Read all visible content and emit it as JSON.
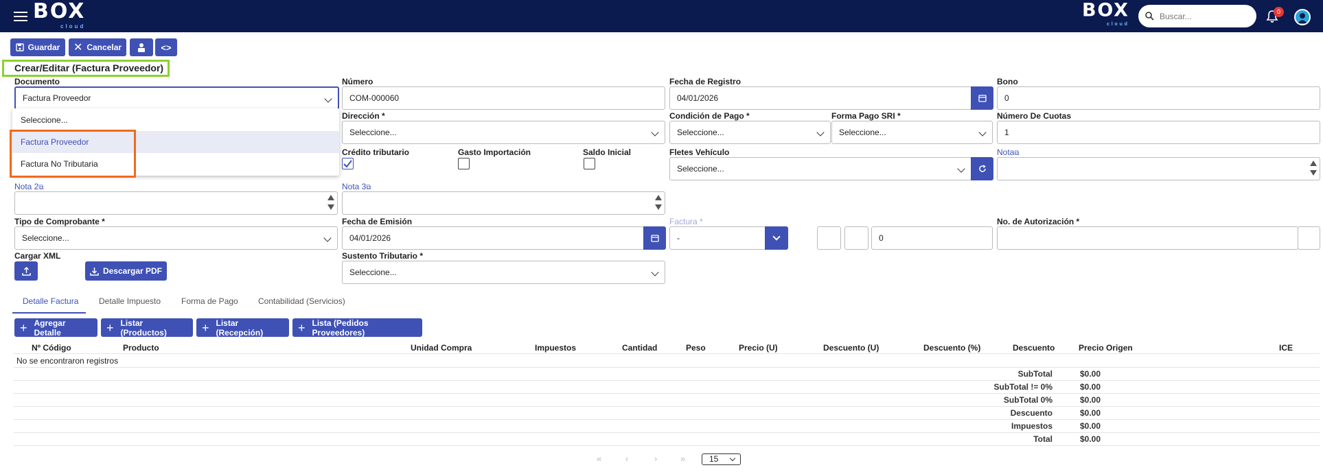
{
  "header": {
    "logo_text": "BOX",
    "logo_sub": "cloud",
    "search_placeholder": "Buscar...",
    "notification_count": "0"
  },
  "toolbar": {
    "save_label": "Guardar",
    "cancel_label": "Cancelar"
  },
  "page_title": "Crear/Editar (Factura Proveedor)",
  "form": {
    "documento": {
      "label": "Documento",
      "value": "Factura Proveedor"
    },
    "documento_options": [
      "Seleccione...",
      "Factura Proveedor",
      "Factura No Tributaria"
    ],
    "numero": {
      "label": "Número",
      "value": "COM-000060"
    },
    "fecha_registro": {
      "label": "Fecha de Registro",
      "value": "04/01/2026"
    },
    "bono": {
      "label": "Bono",
      "value": "0"
    },
    "direccion": {
      "label": "Dirección *",
      "value": "Seleccione..."
    },
    "condicion_pago": {
      "label": "Condición de Pago *",
      "value": "Seleccione..."
    },
    "forma_pago_sri": {
      "label": "Forma Pago SRI *",
      "value": "Seleccione..."
    },
    "numero_cuotas": {
      "label": "Número De Cuotas",
      "value": "1"
    },
    "credito_tributario": {
      "label": "Crédito tributario",
      "checked": true
    },
    "gasto_importacion": {
      "label": "Gasto Importación",
      "checked": false
    },
    "saldo_inicial": {
      "label": "Saldo Inicial",
      "checked": false
    },
    "fletes_vehiculo": {
      "label": "Fletes Vehículo",
      "value": "Seleccione..."
    },
    "nota": {
      "label": "Nota"
    },
    "nota2": {
      "label": "Nota 2"
    },
    "nota3": {
      "label": "Nota 3"
    },
    "tipo_comprobante": {
      "label": "Tipo de Comprobante *",
      "value": "Seleccione..."
    },
    "fecha_emision": {
      "label": "Fecha de Emisión",
      "value": "04/01/2026"
    },
    "factura": {
      "label": "Factura *",
      "value": "-",
      "number": "0"
    },
    "no_autorizacion": {
      "label": "No. de Autorización *",
      "value": ""
    },
    "cargar_xml": {
      "label": "Cargar XML"
    },
    "descargar_pdf": "Descargar PDF",
    "sustento_tributario": {
      "label": "Sustento Tributario *",
      "value": "Seleccione..."
    }
  },
  "tabs": [
    "Detalle Factura",
    "Detalle Impuesto",
    "Forma de Pago",
    "Contabilidad (Servicios)"
  ],
  "actions": [
    "Agregar Detalle",
    "Listar (Productos)",
    "Listar (Recepción)",
    "Lista (Pedidos Proveedores)"
  ],
  "table": {
    "columns": [
      "Nº Código",
      "Producto",
      "Unidad Compra",
      "Impuestos",
      "Cantidad",
      "Peso",
      "Precio (U)",
      "Descuento (U)",
      "Descuento (%)",
      "Descuento",
      "Precio Origen",
      "ICE"
    ],
    "empty_text": "No se encontraron registros"
  },
  "totals": [
    {
      "label": "SubTotal",
      "value": "$0.00"
    },
    {
      "label": "SubTotal != 0%",
      "value": "$0.00"
    },
    {
      "label": "SubTotal 0%",
      "value": "$0.00"
    },
    {
      "label": "Descuento",
      "value": "$0.00"
    },
    {
      "label": "Impuestos",
      "value": "$0.00"
    },
    {
      "label": "Total",
      "value": "$0.00"
    }
  ],
  "pagination": {
    "page_size": "15"
  },
  "colors": {
    "header_bg": "#0b1a4f",
    "primary": "#3f51b5",
    "highlight_green": "#8bd12e",
    "highlight_orange": "#f06a1d"
  }
}
